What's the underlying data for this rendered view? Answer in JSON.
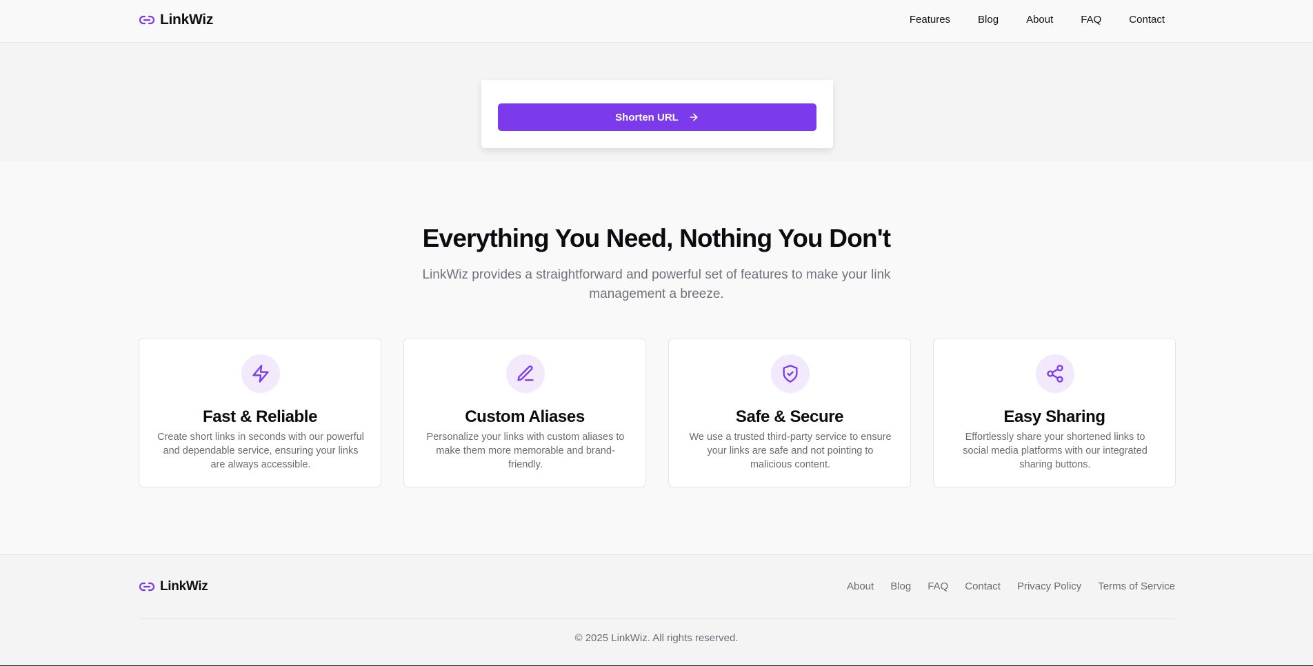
{
  "brand": {
    "name": "LinkWiz",
    "icon": "link-icon",
    "accent": "#7c3aed"
  },
  "nav": {
    "items": [
      {
        "label": "Features"
      },
      {
        "label": "Blog"
      },
      {
        "label": "About"
      },
      {
        "label": "FAQ"
      },
      {
        "label": "Contact"
      }
    ]
  },
  "hero": {
    "shorten_label": "Shorten URL",
    "shorten_icon": "arrow-right-icon"
  },
  "features": {
    "title": "Everything You Need, Nothing You Don't",
    "subtitle": "LinkWiz provides a straightforward and powerful set of features to make your link management a breeze.",
    "cards": [
      {
        "icon": "lightning-icon",
        "title": "Fast & Reliable",
        "description": "Create short links in seconds with our powerful and dependable service, ensuring your links are always accessible."
      },
      {
        "icon": "pencil-icon",
        "title": "Custom Aliases",
        "description": "Personalize your links with custom aliases to make them more memorable and brand-friendly."
      },
      {
        "icon": "shield-check-icon",
        "title": "Safe & Secure",
        "description": "We use a trusted third-party service to ensure your links are safe and not pointing to malicious content."
      },
      {
        "icon": "share-icon",
        "title": "Easy Sharing",
        "description": "Effortlessly share your shortened links to social media platforms with our integrated sharing buttons."
      }
    ]
  },
  "footer": {
    "brand_name": "LinkWiz",
    "links": [
      {
        "label": "About"
      },
      {
        "label": "Blog"
      },
      {
        "label": "FAQ"
      },
      {
        "label": "Contact"
      },
      {
        "label": "Privacy Policy"
      },
      {
        "label": "Terms of Service"
      }
    ],
    "copyright": "© 2025 LinkWiz. All rights reserved."
  }
}
